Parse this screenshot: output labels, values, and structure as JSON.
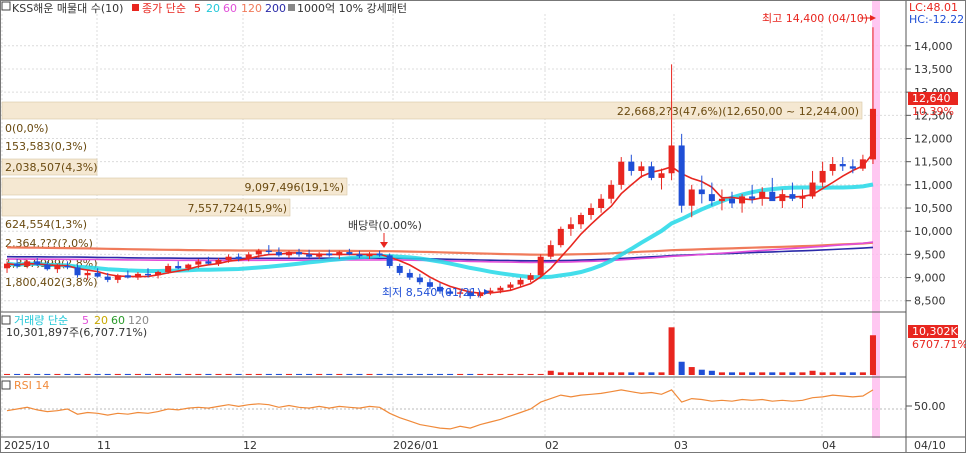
{
  "header": {
    "stock_label": "KSS해운 매물대 수(10)",
    "close_label": "종가 단순",
    "ma_periods": [
      "5",
      "20",
      "60",
      "120",
      "200"
    ],
    "extra_label": "1000억 10% 강세패턴",
    "lc_label": "LC:48.01",
    "hc_label": "HC:-12.22"
  },
  "volume_header": {
    "label": "거래량 단순",
    "ma_periods": [
      "5",
      "20",
      "60",
      "120"
    ],
    "summary": "10,301,897주(6,707.71%)"
  },
  "rsi_header": {
    "label": "RSI 14"
  },
  "annotations": {
    "high": "최고 14,400 (04/10)",
    "low": "최저 8,540 (01/21)",
    "dividend": "배당락(0.00%)"
  },
  "price_axis_labels": [
    "14,000",
    "13,500",
    "13,000",
    "12,500",
    "12,000",
    "11,500",
    "11,000",
    "10,500",
    "10,000",
    "9,500",
    "9,000",
    "8,500"
  ],
  "current_price": {
    "value": "12,640",
    "percent": "10.39%"
  },
  "current_volume": {
    "value": "10,302K",
    "percent": "6707.71%"
  },
  "rsi_axis_label": "50.00",
  "x_axis_labels": [
    "2025/10",
    "11",
    "12",
    "2026/01",
    "02",
    "03",
    "04",
    "04/10"
  ],
  "colors": {
    "up": "#e8261f",
    "down": "#1f4fd6",
    "ma5": "#e8261f",
    "ma20": "#22d8e8",
    "ma60": "#e14fd9",
    "ma120": "#f07a5a",
    "ma200": "#2a2aa8",
    "volume_band": "#f5e8d2",
    "rsi_line": "#f08a3a",
    "highlight": "#ffb9ee"
  },
  "chart_data": {
    "type": "candlestick",
    "price_range": [
      8300,
      14600
    ],
    "volume_profile": [
      {
        "label": "22,668,2?3(47,6%)(12,650,00 ~ 12,244,00)",
        "price_low": 12244,
        "price_high": 12650,
        "ratio": 0.476
      },
      {
        "label": "0(0,0%)",
        "price_low": 11838,
        "price_high": 12244,
        "ratio": 0.0
      },
      {
        "label": "153,583(0,3%)",
        "price_low": 11432,
        "price_high": 11838,
        "ratio": 0.003
      },
      {
        "label": "2,038,507(4,3%)",
        "price_low": 11026,
        "price_high": 11432,
        "ratio": 0.043
      },
      {
        "label": "9,097,496(19,1%)",
        "price_low": 10620,
        "price_high": 11026,
        "ratio": 0.191
      },
      {
        "label": "7,557,724(15,9%)",
        "price_low": 10214,
        "price_high": 10620,
        "ratio": 0.159
      },
      {
        "label": "624,554(1,3%)",
        "price_low": 9808,
        "price_high": 10214,
        "ratio": 0.013
      },
      {
        "label": "2,364,???(?,0%)",
        "price_low": 9402,
        "price_high": 9808,
        "ratio": 0.05
      },
      {
        "label": "1,317,999(2,8%)",
        "price_low": 8996,
        "price_high": 9402,
        "ratio": 0.028
      },
      {
        "label": "1,800,402(3,8%)",
        "price_low": 8590,
        "price_high": 8996,
        "ratio": 0.038
      }
    ],
    "candles": [
      [
        9200,
        9350,
        9100,
        9300
      ],
      [
        9300,
        9400,
        9200,
        9250
      ],
      [
        9250,
        9380,
        9200,
        9350
      ],
      [
        9350,
        9420,
        9250,
        9280
      ],
      [
        9280,
        9350,
        9150,
        9180
      ],
      [
        9180,
        9300,
        9100,
        9250
      ],
      [
        9250,
        9350,
        9180,
        9220
      ],
      [
        9220,
        9280,
        9000,
        9050
      ],
      [
        9050,
        9150,
        8950,
        9100
      ],
      [
        9100,
        9200,
        9000,
        9020
      ],
      [
        9020,
        9100,
        8900,
        8950
      ],
      [
        8950,
        9080,
        8880,
        9050
      ],
      [
        9050,
        9150,
        8980,
        9000
      ],
      [
        9000,
        9120,
        8950,
        9080
      ],
      [
        9080,
        9200,
        9000,
        9050
      ],
      [
        9050,
        9150,
        8980,
        9120
      ],
      [
        9120,
        9300,
        9080,
        9250
      ],
      [
        9250,
        9350,
        9180,
        9200
      ],
      [
        9200,
        9300,
        9150,
        9280
      ],
      [
        9280,
        9400,
        9200,
        9350
      ],
      [
        9350,
        9450,
        9280,
        9300
      ],
      [
        9300,
        9420,
        9250,
        9380
      ],
      [
        9380,
        9500,
        9320,
        9450
      ],
      [
        9450,
        9520,
        9350,
        9400
      ],
      [
        9400,
        9550,
        9350,
        9500
      ],
      [
        9500,
        9620,
        9420,
        9580
      ],
      [
        9580,
        9700,
        9500,
        9550
      ],
      [
        9550,
        9650,
        9450,
        9480
      ],
      [
        9480,
        9580,
        9420,
        9550
      ],
      [
        9550,
        9620,
        9450,
        9500
      ],
      [
        9500,
        9600,
        9420,
        9450
      ],
      [
        9450,
        9550,
        9400,
        9520
      ],
      [
        9520,
        9600,
        9450,
        9480
      ],
      [
        9480,
        9580,
        9400,
        9550
      ],
      [
        9550,
        9620,
        9480,
        9500
      ],
      [
        9500,
        9580,
        9420,
        9460
      ],
      [
        9460,
        9550,
        9400,
        9520
      ],
      [
        9520,
        9580,
        9450,
        9480
      ],
      [
        9480,
        9520,
        9200,
        9250
      ],
      [
        9250,
        9300,
        9050,
        9100
      ],
      [
        9100,
        9180,
        8950,
        9000
      ],
      [
        9000,
        9080,
        8850,
        8900
      ],
      [
        8900,
        8980,
        8750,
        8800
      ],
      [
        8800,
        8880,
        8650,
        8700
      ],
      [
        8700,
        8780,
        8600,
        8650
      ],
      [
        8650,
        8720,
        8560,
        8680
      ],
      [
        8680,
        8760,
        8540,
        8600
      ],
      [
        8600,
        8700,
        8560,
        8680
      ],
      [
        8680,
        8780,
        8620,
        8720
      ],
      [
        8720,
        8820,
        8660,
        8780
      ],
      [
        8780,
        8900,
        8720,
        8850
      ],
      [
        8850,
        9000,
        8800,
        8950
      ],
      [
        8950,
        9100,
        8900,
        9050
      ],
      [
        9050,
        9500,
        9000,
        9450
      ],
      [
        9450,
        9800,
        9400,
        9700
      ],
      [
        9700,
        10100,
        9650,
        10050
      ],
      [
        10050,
        10300,
        9900,
        10150
      ],
      [
        10150,
        10400,
        10050,
        10350
      ],
      [
        10350,
        10600,
        10250,
        10500
      ],
      [
        10500,
        10800,
        10400,
        10700
      ],
      [
        10700,
        11100,
        10600,
        11000
      ],
      [
        11000,
        11600,
        10900,
        11500
      ],
      [
        11500,
        11650,
        11200,
        11300
      ],
      [
        11300,
        11500,
        11150,
        11400
      ],
      [
        11400,
        11500,
        11100,
        11150
      ],
      [
        11150,
        11350,
        10900,
        11250
      ],
      [
        11250,
        13600,
        11100,
        11850
      ],
      [
        11850,
        12100,
        10400,
        10550
      ],
      [
        10550,
        11000,
        10300,
        10900
      ],
      [
        10900,
        11200,
        10600,
        10800
      ],
      [
        10800,
        11050,
        10550,
        10650
      ],
      [
        10650,
        10900,
        10450,
        10700
      ],
      [
        10700,
        10850,
        10500,
        10600
      ],
      [
        10600,
        10800,
        10400,
        10750
      ],
      [
        10750,
        11000,
        10600,
        10700
      ],
      [
        10700,
        10950,
        10550,
        10850
      ],
      [
        10850,
        11150,
        10700,
        10650
      ],
      [
        10650,
        10900,
        10500,
        10800
      ],
      [
        10800,
        11050,
        10650,
        10700
      ],
      [
        10700,
        10900,
        10500,
        10750
      ],
      [
        10750,
        11300,
        10700,
        11050
      ],
      [
        11050,
        11500,
        10950,
        11300
      ],
      [
        11300,
        11600,
        11200,
        11450
      ],
      [
        11450,
        11600,
        11300,
        11400
      ],
      [
        11400,
        11550,
        11250,
        11350
      ],
      [
        11350,
        11650,
        11300,
        11550
      ],
      [
        11550,
        14400,
        11450,
        12640
      ]
    ],
    "volume": [
      0.02,
      0.02,
      0.02,
      0.02,
      0.02,
      0.02,
      0.02,
      0.02,
      0.02,
      0.02,
      0.02,
      0.02,
      0.02,
      0.02,
      0.02,
      0.02,
      0.02,
      0.02,
      0.02,
      0.02,
      0.02,
      0.02,
      0.02,
      0.02,
      0.02,
      0.02,
      0.02,
      0.02,
      0.02,
      0.02,
      0.02,
      0.02,
      0.02,
      0.02,
      0.02,
      0.02,
      0.02,
      0.02,
      0.02,
      0.02,
      0.02,
      0.02,
      0.02,
      0.02,
      0.02,
      0.02,
      0.02,
      0.02,
      0.02,
      0.02,
      0.02,
      0.02,
      0.02,
      0.02,
      0.08,
      0.05,
      0.05,
      0.05,
      0.05,
      0.05,
      0.05,
      0.05,
      0.05,
      0.05,
      0.05,
      0.05,
      0.9,
      0.25,
      0.15,
      0.1,
      0.08,
      0.05,
      0.05,
      0.05,
      0.05,
      0.05,
      0.05,
      0.05,
      0.05,
      0.05,
      0.08,
      0.05,
      0.05,
      0.05,
      0.05,
      0.05,
      0.75
    ],
    "rsi": [
      48,
      50,
      52,
      49,
      47,
      48,
      50,
      44,
      46,
      45,
      43,
      45,
      44,
      46,
      45,
      47,
      50,
      49,
      51,
      52,
      51,
      53,
      55,
      53,
      55,
      56,
      55,
      52,
      54,
      52,
      51,
      53,
      51,
      53,
      52,
      51,
      53,
      52,
      45,
      40,
      36,
      32,
      30,
      28,
      27,
      30,
      28,
      32,
      35,
      38,
      42,
      46,
      50,
      58,
      62,
      66,
      64,
      66,
      67,
      68,
      70,
      72,
      70,
      68,
      69,
      67,
      72,
      58,
      62,
      61,
      59,
      60,
      59,
      61,
      60,
      61,
      59,
      60,
      59,
      60,
      63,
      64,
      66,
      65,
      64,
      65,
      72
    ]
  }
}
